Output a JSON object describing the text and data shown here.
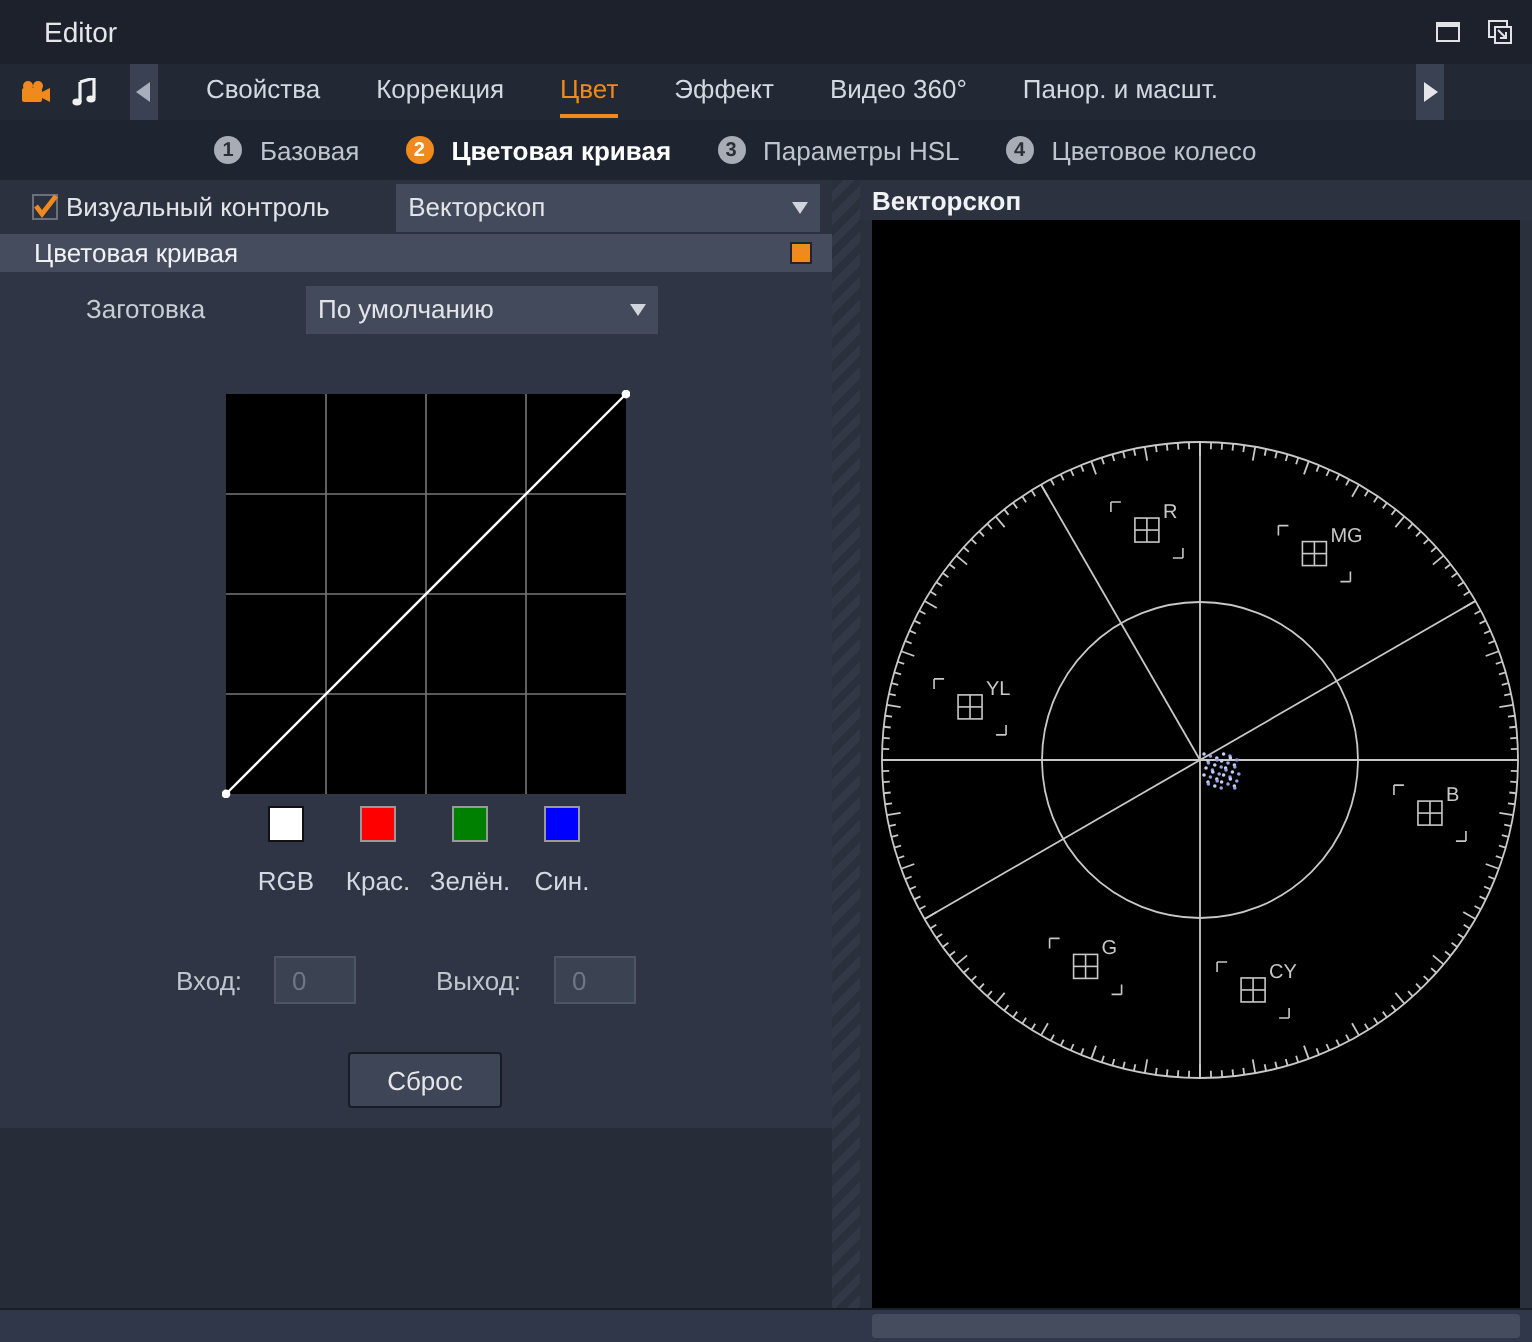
{
  "window": {
    "title": "Editor"
  },
  "tabs": [
    {
      "label": "Свойства",
      "selected": false
    },
    {
      "label": "Коррекция",
      "selected": false
    },
    {
      "label": "Цвет",
      "selected": true
    },
    {
      "label": "Эффект",
      "selected": false
    },
    {
      "label": "Видео 360°",
      "selected": false
    },
    {
      "label": "Панор. и масшт.",
      "selected": false
    }
  ],
  "subtabs": [
    {
      "number": "1",
      "label": "Базовая",
      "selected": false
    },
    {
      "number": "2",
      "label": "Цветовая кривая",
      "selected": true
    },
    {
      "number": "3",
      "label": "Параметры HSL",
      "selected": false
    },
    {
      "number": "4",
      "label": "Цветовое колесо",
      "selected": false
    }
  ],
  "visual_control": {
    "label": "Визуальный контроль",
    "checked": true,
    "value": "Векторскоп"
  },
  "section": {
    "title": "Цветовая кривая"
  },
  "preset": {
    "label": "Заготовка",
    "value": "По умолчанию"
  },
  "channels": [
    {
      "label": "RGB",
      "color": "#ffffff"
    },
    {
      "label": "Крас.",
      "color": "#ff0000"
    },
    {
      "label": "Зелён.",
      "color": "#008000"
    },
    {
      "label": "Син.",
      "color": "#0000ff"
    }
  ],
  "input": {
    "label": "Вход:",
    "value": "0",
    "disabled": true
  },
  "output": {
    "label": "Выход:",
    "value": "0",
    "disabled": true
  },
  "reset_button": "Сброс",
  "scope": {
    "title": "Векторскоп",
    "targets": [
      {
        "label": "R"
      },
      {
        "label": "MG"
      },
      {
        "label": "YL"
      },
      {
        "label": "B"
      },
      {
        "label": "G"
      },
      {
        "label": "CY"
      }
    ]
  }
}
